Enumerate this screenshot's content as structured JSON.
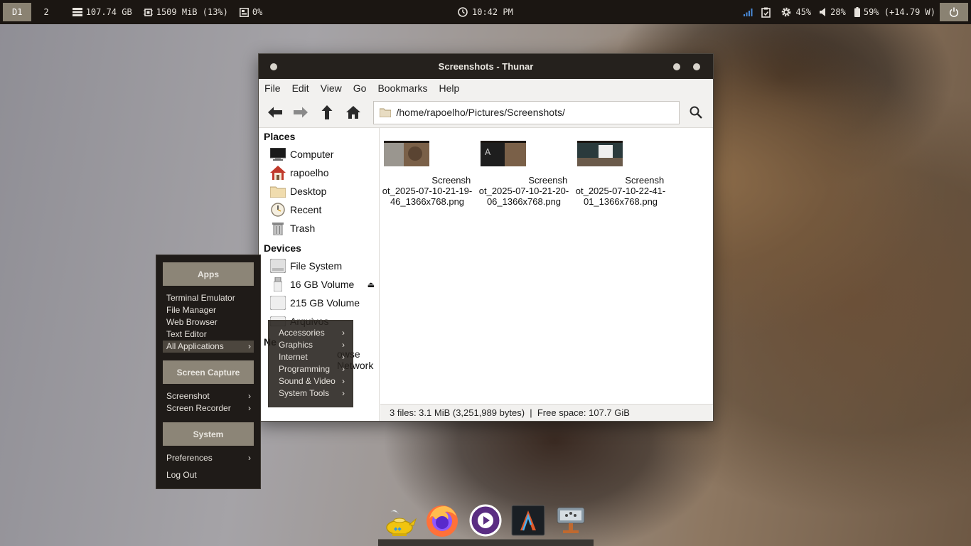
{
  "panel": {
    "workspaces": [
      "D1",
      "2"
    ],
    "disk": "107.74 GB",
    "memory": "1509 MiB (13%)",
    "cpu": "0%",
    "clock": "10:42 PM",
    "brightness": "45%",
    "volume": "28%",
    "battery": "59% (+14.79 W)"
  },
  "window": {
    "title": "Screenshots - Thunar",
    "menu": [
      "File",
      "Edit",
      "View",
      "Go",
      "Bookmarks",
      "Help"
    ],
    "location": "/home/rapoelho/Pictures/Screenshots/",
    "sidebar": {
      "places_label": "Places",
      "places": [
        "Computer",
        "rapoelho",
        "Desktop",
        "Recent",
        "Trash"
      ],
      "devices_label": "Devices",
      "devices": [
        "File System",
        "16 GB Volume",
        "215 GB Volume",
        "Arquivos"
      ],
      "network_label": "Ne",
      "network_item": "owse Network"
    },
    "files": [
      "Screenshot_2025-07-10-21-19-46_1366x768.png",
      "Screenshot_2025-07-10-21-20-06_1366x768.png",
      "Screenshot_2025-07-10-22-41-01_1366x768.png"
    ],
    "status": "3 files: 3.1 MiB (3,251,989 bytes)  |  Free space: 107.7 GiB"
  },
  "appmenu": {
    "apps_header": "Apps",
    "apps": [
      "Terminal Emulator",
      "File Manager",
      "Web Browser",
      "Text Editor",
      "All Applications"
    ],
    "capture_header": "Screen Capture",
    "capture": [
      "Screenshot",
      "Screen Recorder"
    ],
    "system_header": "System",
    "system": [
      "Preferences",
      "Log Out"
    ]
  },
  "submenu": {
    "items": [
      "Accessories",
      "Graphics",
      "Internet",
      "Programming",
      "Sound & Video",
      "System Tools"
    ]
  },
  "dock": {
    "icons": [
      "genie-lamp-icon",
      "firefox-icon",
      "media-player-icon",
      "terminal-icon",
      "network-icon"
    ]
  },
  "colors": {
    "panel_bg": "#1b1612",
    "accent": "#8a8272",
    "titlebar": "#25211d",
    "menu_header": "#8c8577"
  }
}
